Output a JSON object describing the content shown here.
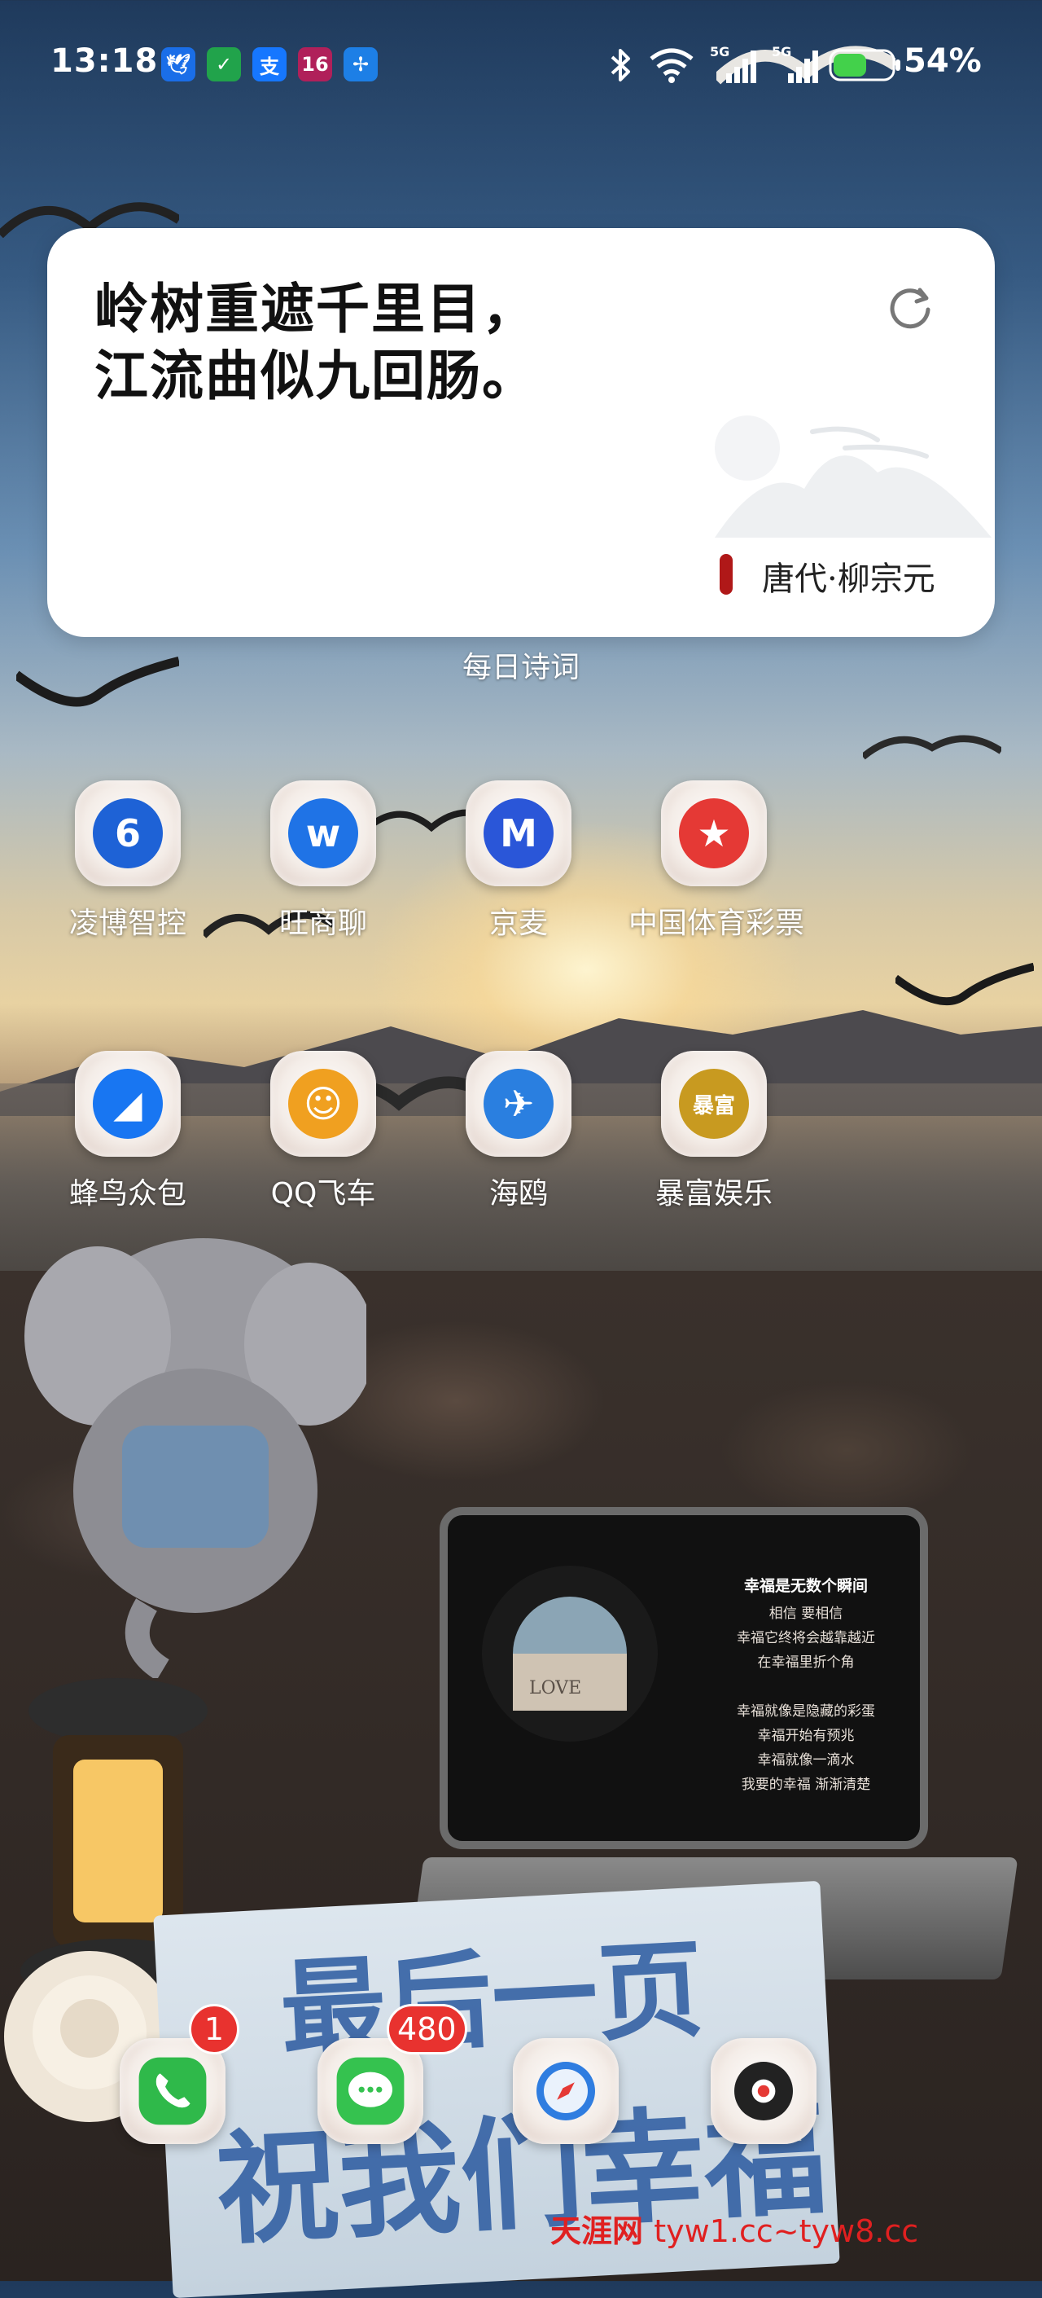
{
  "status_bar": {
    "time": "13:18",
    "notif_icons": [
      {
        "name": "bird-app-icon",
        "text": "🕊",
        "bg": "#1a6ee8"
      },
      {
        "name": "shield-icon",
        "text": "✓",
        "bg": "#21a34b"
      },
      {
        "name": "alipay-icon",
        "text": "支",
        "bg": "#1677ff"
      },
      {
        "name": "app-16-icon",
        "text": "16",
        "bg": "#b0205a"
      },
      {
        "name": "telecom-icon",
        "text": "✢",
        "bg": "#1d7fe6"
      }
    ],
    "battery": "54%",
    "network1": "5G",
    "network2": "5G"
  },
  "widget": {
    "poem_line1": "岭树重遮千里目，",
    "poem_line2": "江流曲似九回肠。",
    "author": "唐代·柳宗元",
    "label": "每日诗词"
  },
  "apps_row1": [
    {
      "label": "凌博智控",
      "icon": "lingbo-icon",
      "glyph": "6",
      "color": "#1e62d6"
    },
    {
      "label": "旺商聊",
      "icon": "wangshang-icon",
      "glyph": "w",
      "color": "#1f73e6"
    },
    {
      "label": "京麦",
      "icon": "jingmai-icon",
      "glyph": "M",
      "color": "#2a56d8"
    },
    {
      "label": "中国体育彩票",
      "icon": "lottery-star-icon",
      "glyph": "★",
      "color": "#e53935"
    }
  ],
  "apps_row2": [
    {
      "label": "蜂鸟众包",
      "icon": "fengniao-icon",
      "glyph": "◢",
      "color": "#1876f2"
    },
    {
      "label": "QQ飞车",
      "icon": "qq-racer-icon",
      "glyph": "☺",
      "color": "#f0a020"
    },
    {
      "label": "海鸥",
      "icon": "seagull-icon",
      "glyph": "✈",
      "color": "#2a7fe0"
    },
    {
      "label": "暴富娱乐",
      "icon": "baofu-icon",
      "glyph": "暴富",
      "color": "#c89a20"
    }
  ],
  "dock": [
    {
      "name": "phone",
      "icon": "phone-icon",
      "badge": "1"
    },
    {
      "name": "messages",
      "icon": "message-icon",
      "badge": "480"
    },
    {
      "name": "browser",
      "icon": "compass-icon",
      "badge": ""
    },
    {
      "name": "music",
      "icon": "record-icon",
      "badge": ""
    }
  ],
  "wallpaper": {
    "tablet_title": "幸福是无数个瞬间",
    "tablet_lines": [
      "相信 要相信",
      "幸福它终将会越靠越近",
      "在幸福里折个角",
      "",
      "幸福就像是隐藏的彩蛋",
      "幸福开始有预兆",
      "幸福就像一滴水",
      "我要的幸福 渐渐清楚"
    ],
    "record_text": "LOVE",
    "notebook_line1": "最后一页",
    "notebook_line2": "祝我们幸福",
    "watermark_cn": "天涯网",
    "watermark_url": "tyw1.cc~tyw8.cc"
  }
}
